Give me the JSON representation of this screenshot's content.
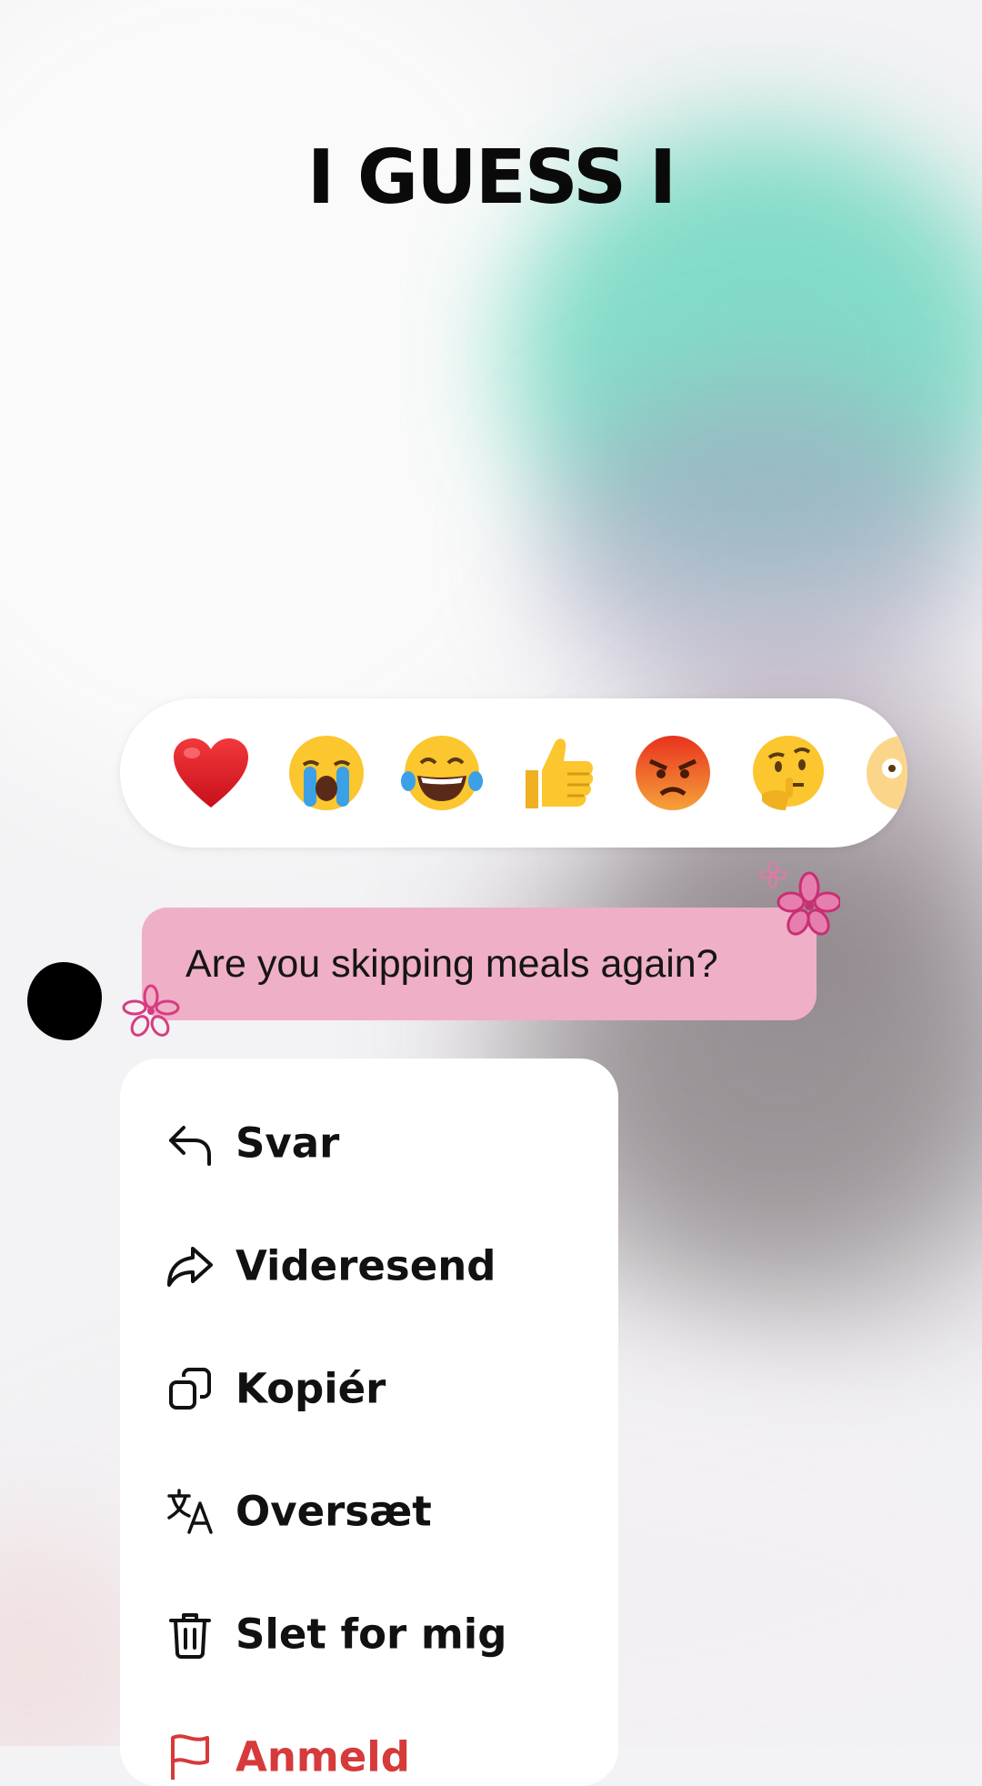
{
  "headline": "I GUESS I",
  "reactions": [
    {
      "name": "heart",
      "glyph": "❤️"
    },
    {
      "name": "crying",
      "glyph": "😭"
    },
    {
      "name": "laughing",
      "glyph": "😂"
    },
    {
      "name": "thumbs-up",
      "glyph": "👍"
    },
    {
      "name": "angry",
      "glyph": "😡"
    },
    {
      "name": "thinking",
      "glyph": "🤔"
    },
    {
      "name": "shocked",
      "glyph": "😳"
    }
  ],
  "message": {
    "text": "Are you skipping meals again?"
  },
  "menu": {
    "items": [
      {
        "label": "Svar",
        "icon": "reply-icon"
      },
      {
        "label": "Videresend",
        "icon": "forward-icon"
      },
      {
        "label": "Kopiér",
        "icon": "copy-icon"
      },
      {
        "label": "Oversæt",
        "icon": "translate-icon"
      },
      {
        "label": "Slet for mig",
        "icon": "trash-icon"
      },
      {
        "label": "Anmeld",
        "icon": "flag-icon",
        "danger_color": "#d63a3a"
      }
    ]
  },
  "colors": {
    "bubble": "#efafc6",
    "flower": "#d83b82",
    "danger": "#d63a3a"
  }
}
